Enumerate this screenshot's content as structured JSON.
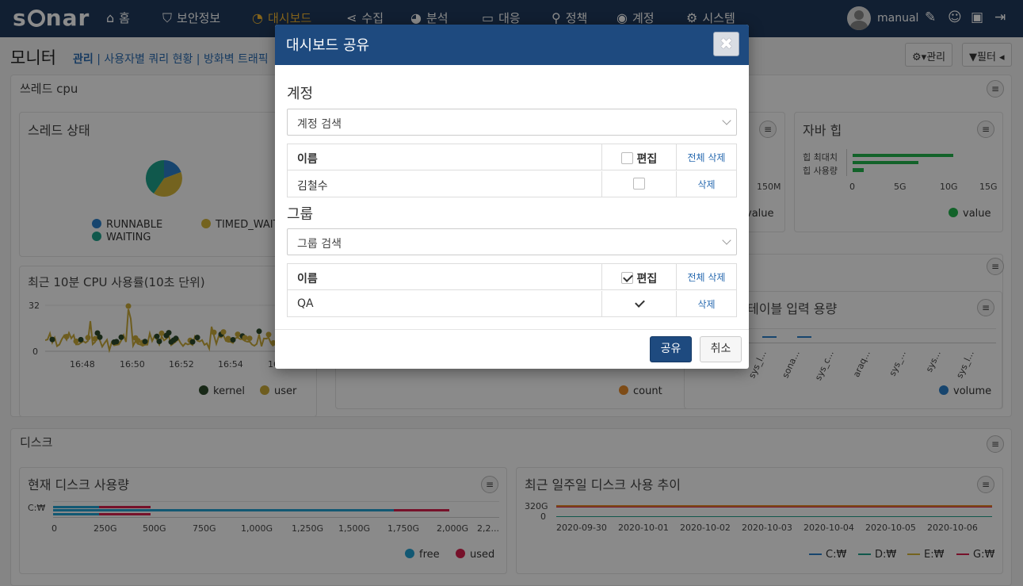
{
  "app": {
    "logo": "sonar"
  },
  "nav": {
    "items": [
      {
        "label": "홈",
        "icon": "home-icon"
      },
      {
        "label": "보안정보",
        "icon": "shield-icon"
      },
      {
        "label": "대시보드",
        "icon": "dashboard-icon",
        "active": true
      },
      {
        "label": "수집",
        "icon": "share-icon"
      },
      {
        "label": "분석",
        "icon": "pie-icon"
      },
      {
        "label": "대응",
        "icon": "laptop-icon"
      },
      {
        "label": "정책",
        "icon": "search-icon"
      },
      {
        "label": "계정",
        "icon": "user-icon"
      },
      {
        "label": "시스템",
        "icon": "gear-icon"
      }
    ],
    "username": "manual"
  },
  "header": {
    "title": "모니터",
    "breadcrumb_active": "관리",
    "breadcrumb_rest": " | 사용자별 쿼리 현황 | 방화벽 트래픽",
    "manage_label": "관리",
    "filter_label": "필터"
  },
  "sections": {
    "thread_cpu": "쓰레드 cpu",
    "disk": "디스크"
  },
  "panels": {
    "thread_state": {
      "title": "스레드 상태",
      "legend": [
        "RUNNABLE",
        "TIMED_WAITING",
        "WAITING"
      ]
    },
    "java_heap": {
      "title": "자바 힙",
      "legend": "value",
      "categories": [
        "힙 최대치",
        "힙 사용량"
      ],
      "ticks": [
        "0",
        "5G",
        "10G",
        "15G"
      ]
    },
    "mid_right_partial": {
      "tick": "150M",
      "legend": "value"
    },
    "cpu_usage": {
      "title": "최근 10분 CPU 사용률(10초 단위)",
      "yticks": [
        "32",
        "0"
      ],
      "xticks": [
        "16:48",
        "16:50",
        "16:52",
        "16:54",
        "16"
      ],
      "legend": [
        "kernel",
        "user"
      ]
    },
    "count_panel": {
      "legend": "count"
    },
    "table_input": {
      "title": "테이블 입력 용량",
      "xticks": [
        "sys_l...",
        "sona...",
        "sys_c...",
        "araq...",
        "sys_...",
        "sys...",
        "sys_l..."
      ],
      "legend": "volume"
    },
    "disk_now": {
      "title": "현재 디스크 사용량",
      "category": "C:₩",
      "ticks": [
        "0",
        "250G",
        "500G",
        "750G",
        "1,000G",
        "1,250G",
        "1,500G",
        "1,750G",
        "2,000G",
        "2,2..."
      ],
      "legend": [
        "free",
        "used"
      ]
    },
    "disk_week": {
      "title": "최근 일주일 디스크 사용 추이",
      "yticks": [
        "320G",
        "0"
      ],
      "xticks": [
        "2020-09-30",
        "2020-10-01",
        "2020-10-02",
        "2020-10-03",
        "2020-10-04",
        "2020-10-05",
        "2020-10-06"
      ],
      "legend": [
        "C:₩",
        "D:₩",
        "E:₩",
        "G:₩"
      ]
    }
  },
  "colors": {
    "runnable": "#2b7fc9",
    "timed_waiting": "#d4b43a",
    "waiting": "#1ea18a",
    "kernel": "#2d4a2a",
    "user": "#c8a93a",
    "green": "#22b24c",
    "orange": "#e58a2a",
    "free": "#21a0d2",
    "used": "#d8204d"
  },
  "modal": {
    "title": "대시보드 공유",
    "account_section": "계정",
    "account_search": "계정 검색",
    "account_table": {
      "col_name": "이름",
      "col_edit": "편집",
      "delete_all": "전체 삭제",
      "rows": [
        {
          "name": "김철수",
          "edit": false,
          "delete": "삭제"
        }
      ]
    },
    "group_section": "그룹",
    "group_search": "그룹 검색",
    "group_table": {
      "col_name": "이름",
      "col_edit": "편집",
      "delete_all": "전체 삭제",
      "rows": [
        {
          "name": "QA",
          "edit": true,
          "delete": "삭제"
        }
      ]
    },
    "share_label": "공유",
    "cancel_label": "취소"
  }
}
